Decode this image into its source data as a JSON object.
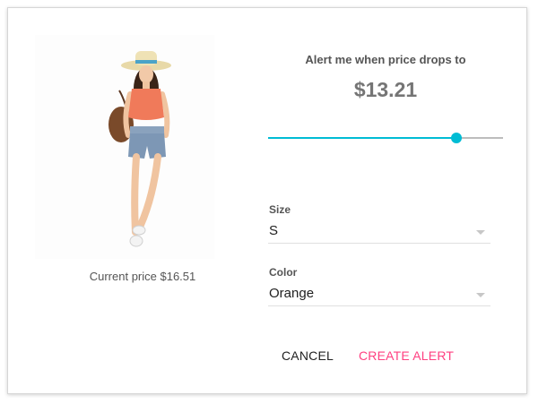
{
  "product": {
    "image_alt": "Woman in sun hat, coral top and denim shorts",
    "current_price_text": "Current price $16.51"
  },
  "alert": {
    "heading": "Alert me when price drops to",
    "price": "$13.21",
    "slider_fraction": 0.8
  },
  "size": {
    "label": "Size",
    "value": "S"
  },
  "color": {
    "label": "Color",
    "value": "Orange"
  },
  "actions": {
    "cancel_label": "CANCEL",
    "create_label": "CREATE ALERT"
  },
  "colors": {
    "accent": "#00bcd4",
    "primary_action": "#ff4081"
  }
}
